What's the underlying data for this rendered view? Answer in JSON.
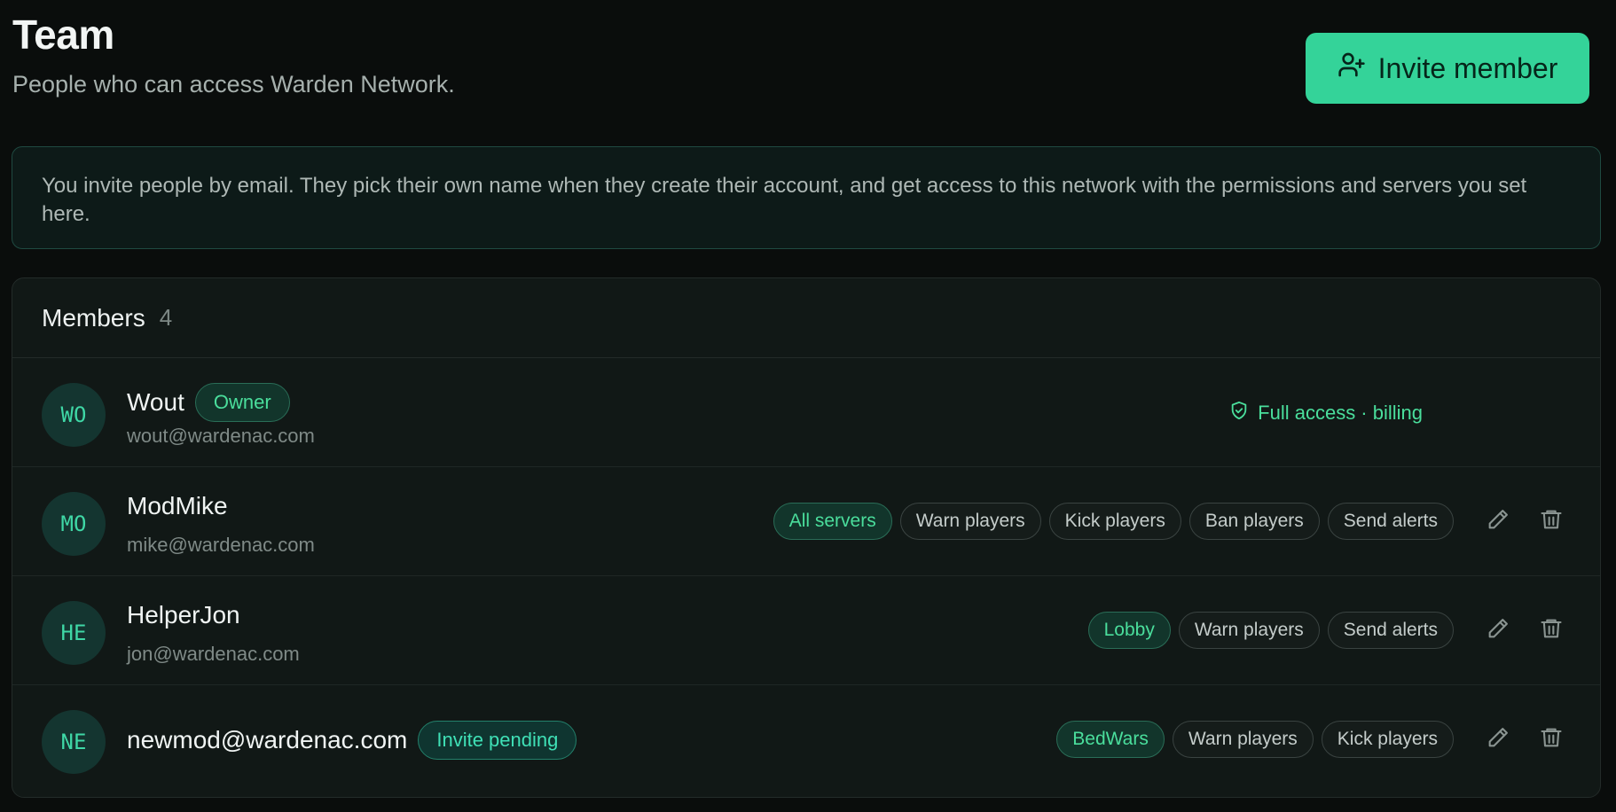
{
  "header": {
    "title": "Team",
    "subtitle": "People who can access Warden Network.",
    "invite_label": "Invite member"
  },
  "banner": {
    "text": "You invite people by email. They pick their own name when they create their account, and get access to this network with the permissions and servers you set here."
  },
  "members": {
    "label": "Members",
    "count": "4",
    "rows": [
      {
        "initials": "WO",
        "name": "Wout",
        "badge": "Owner",
        "email": "wout@wardenac.com",
        "access": "Full access · billing"
      },
      {
        "initials": "MO",
        "name": "ModMike",
        "email": "mike@wardenac.com",
        "tags": [
          "All servers",
          "Warn players",
          "Kick players",
          "Ban players",
          "Send alerts"
        ]
      },
      {
        "initials": "HE",
        "name": "HelperJon",
        "email": "jon@wardenac.com",
        "tags": [
          "Lobby",
          "Warn players",
          "Send alerts"
        ]
      },
      {
        "initials": "NE",
        "name": "newmod@wardenac.com",
        "badge": "Invite pending",
        "tags": [
          "BedWars",
          "Warn players",
          "Kick players"
        ]
      }
    ]
  },
  "colors": {
    "accent": "#34d399",
    "background": "#0a0d0c",
    "card": "#111816"
  },
  "icons": {
    "invite": "user-plus-icon",
    "access": "shield-check-icon",
    "edit": "pencil-icon",
    "delete": "trash-icon"
  }
}
